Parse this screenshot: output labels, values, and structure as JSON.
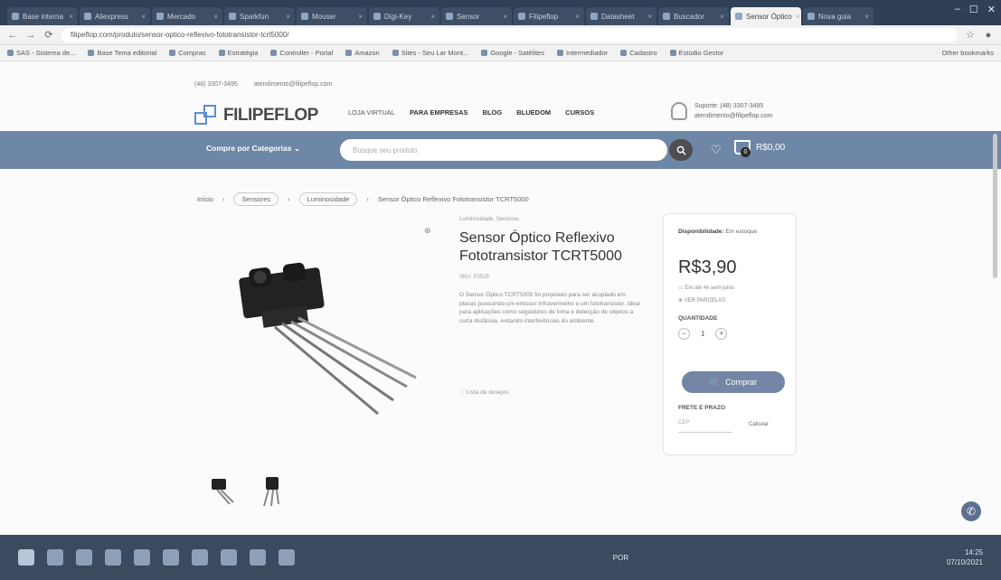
{
  "browser": {
    "tabs": [
      {
        "label": "Base interna"
      },
      {
        "label": "Aliexpress"
      },
      {
        "label": "Mercado"
      },
      {
        "label": "Sparkfun"
      },
      {
        "label": "Mouser"
      },
      {
        "label": "Digi-Key"
      },
      {
        "label": "Sensor"
      },
      {
        "label": "Filipeflop"
      },
      {
        "label": "Datasheet"
      },
      {
        "label": "Buscador"
      },
      {
        "label": "Sensor Óptico",
        "active": true
      },
      {
        "label": "Nova guia"
      }
    ],
    "address": "filipeflop.com/produto/sensor-optico-reflexivo-fototransistor-tcrt5000/",
    "bookmarks": [
      "SAS - Sistema de...",
      "Base Tema editorial",
      "Compras",
      "Estratégia",
      "Controller - Portal",
      "Amazon",
      "Sites - Seu Lar Mont...",
      "Google - Satélites",
      "Intermediador",
      "Cadastro",
      "Estúdio Gestor"
    ],
    "other_bookmarks": "Other bookmarks"
  },
  "site": {
    "phone": "(48) 3307-3495",
    "email": "atendimento@filipeflop.com",
    "logo": "FILIPEFLOP",
    "nav": [
      "LOJA VIRTUAL",
      "PARA EMPRESAS",
      "BLOG",
      "BLUEDOM",
      "CURSOS"
    ],
    "support_title": "Suporte: (48) 3307-3495",
    "support_email": "atendimento@filipeflop.com",
    "categories_btn": "Compre por Categorias",
    "search_placeholder": "Busque seu produto",
    "cart_total": "R$0,00",
    "cart_count": "0"
  },
  "breadcrumb": [
    "Início",
    "Sensores",
    "Luminosidade",
    "Sensor Óptico Reflexivo Fototransistor TCRT5000"
  ],
  "product": {
    "category": "Luminosidade, Sensores",
    "title": "Sensor Óptico Reflexivo Fototransistor TCRT5000",
    "sku": "SKU: P2525",
    "description": "O Sensor Óptico TCRT5000 foi projetado para ser acoplado em placas possuindo um emissor infravermelho e um fototransistor. Ideal para aplicações como seguidores de linha e detecção de objetos a curta distância, evitando interferências do ambiente.",
    "share": "Lista de desejos",
    "stock": "Disponibilidade:",
    "stock_value": "Em estoque",
    "price": "R$3,90",
    "installments": "Em até 4x sem juros",
    "payment": "VER PARCELAS",
    "qty_label": "QUANTIDADE",
    "qty": "1",
    "buy": "Comprar",
    "shipping_label": "FRETE E PRAZO",
    "cep_placeholder": "CEP",
    "calc": "Calcular"
  },
  "taskbar": {
    "time": "14:25",
    "date": "07/10/2021",
    "lang": "POR"
  }
}
